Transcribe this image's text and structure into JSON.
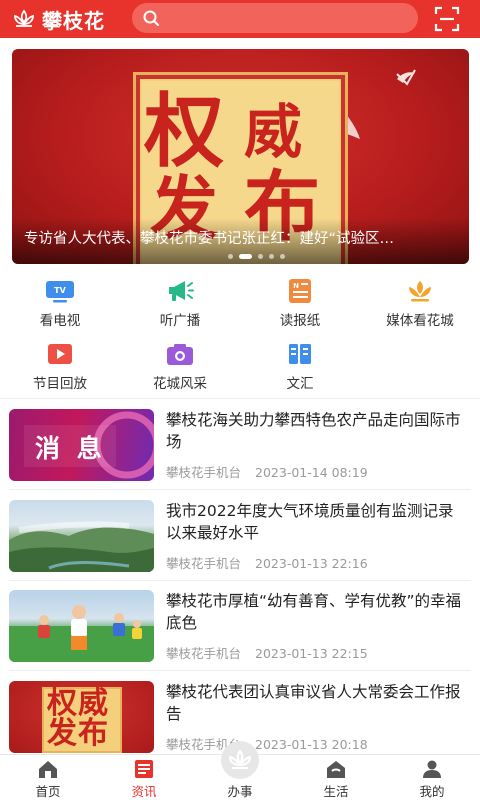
{
  "header": {
    "app_name": "攀枝花",
    "search_placeholder": "",
    "brand_color": "#e8332c"
  },
  "banner": {
    "image_text_line1_left": "权",
    "image_text_line1_right": "威",
    "image_text_line2_left": "发",
    "image_text_line2_right": "布",
    "caption": "专访省人大代表、攀枝花市委书记张正红：建好“试验区…",
    "slide_count": 5,
    "active_slide": 2
  },
  "quick_links": [
    {
      "label": "看电视",
      "icon": "tv-icon"
    },
    {
      "label": "听广播",
      "icon": "megaphone-icon"
    },
    {
      "label": "读报纸",
      "icon": "newspaper-icon"
    },
    {
      "label": "媒体看花城",
      "icon": "flower-icon"
    },
    {
      "label": "节目回放",
      "icon": "play-icon"
    },
    {
      "label": "花城风采",
      "icon": "camera-icon"
    },
    {
      "label": "文汇",
      "icon": "book-icon"
    }
  ],
  "news": [
    {
      "title": "攀枝花海关助力攀西特色农产品走向国际市场",
      "source": "攀枝花手机台",
      "date": "2023-01-14 08:19",
      "thumb_text": "消 息"
    },
    {
      "title": "我市2022年度大气环境质量创有监测记录以来最好水平",
      "source": "攀枝花手机台",
      "date": "2023-01-13 22:16",
      "thumb_text": ""
    },
    {
      "title": "攀枝花市厚植“幼有善育、学有优教”的幸福底色",
      "source": "攀枝花手机台",
      "date": "2023-01-13 22:15",
      "thumb_text": ""
    },
    {
      "title": "攀枝花代表团认真审议省人大常委会工作报告",
      "source": "攀枝花手机台",
      "date": "2023-01-13 20:18",
      "thumb_text": "权威发布"
    }
  ],
  "bottom_nav": [
    {
      "label": "首页",
      "icon": "home-icon",
      "active": false
    },
    {
      "label": "资讯",
      "icon": "news-list-icon",
      "active": true
    },
    {
      "label": "办事",
      "icon": "service-flower-icon",
      "active": false
    },
    {
      "label": "生活",
      "icon": "life-house-icon",
      "active": false
    },
    {
      "label": "我的",
      "icon": "user-icon",
      "active": false
    }
  ]
}
